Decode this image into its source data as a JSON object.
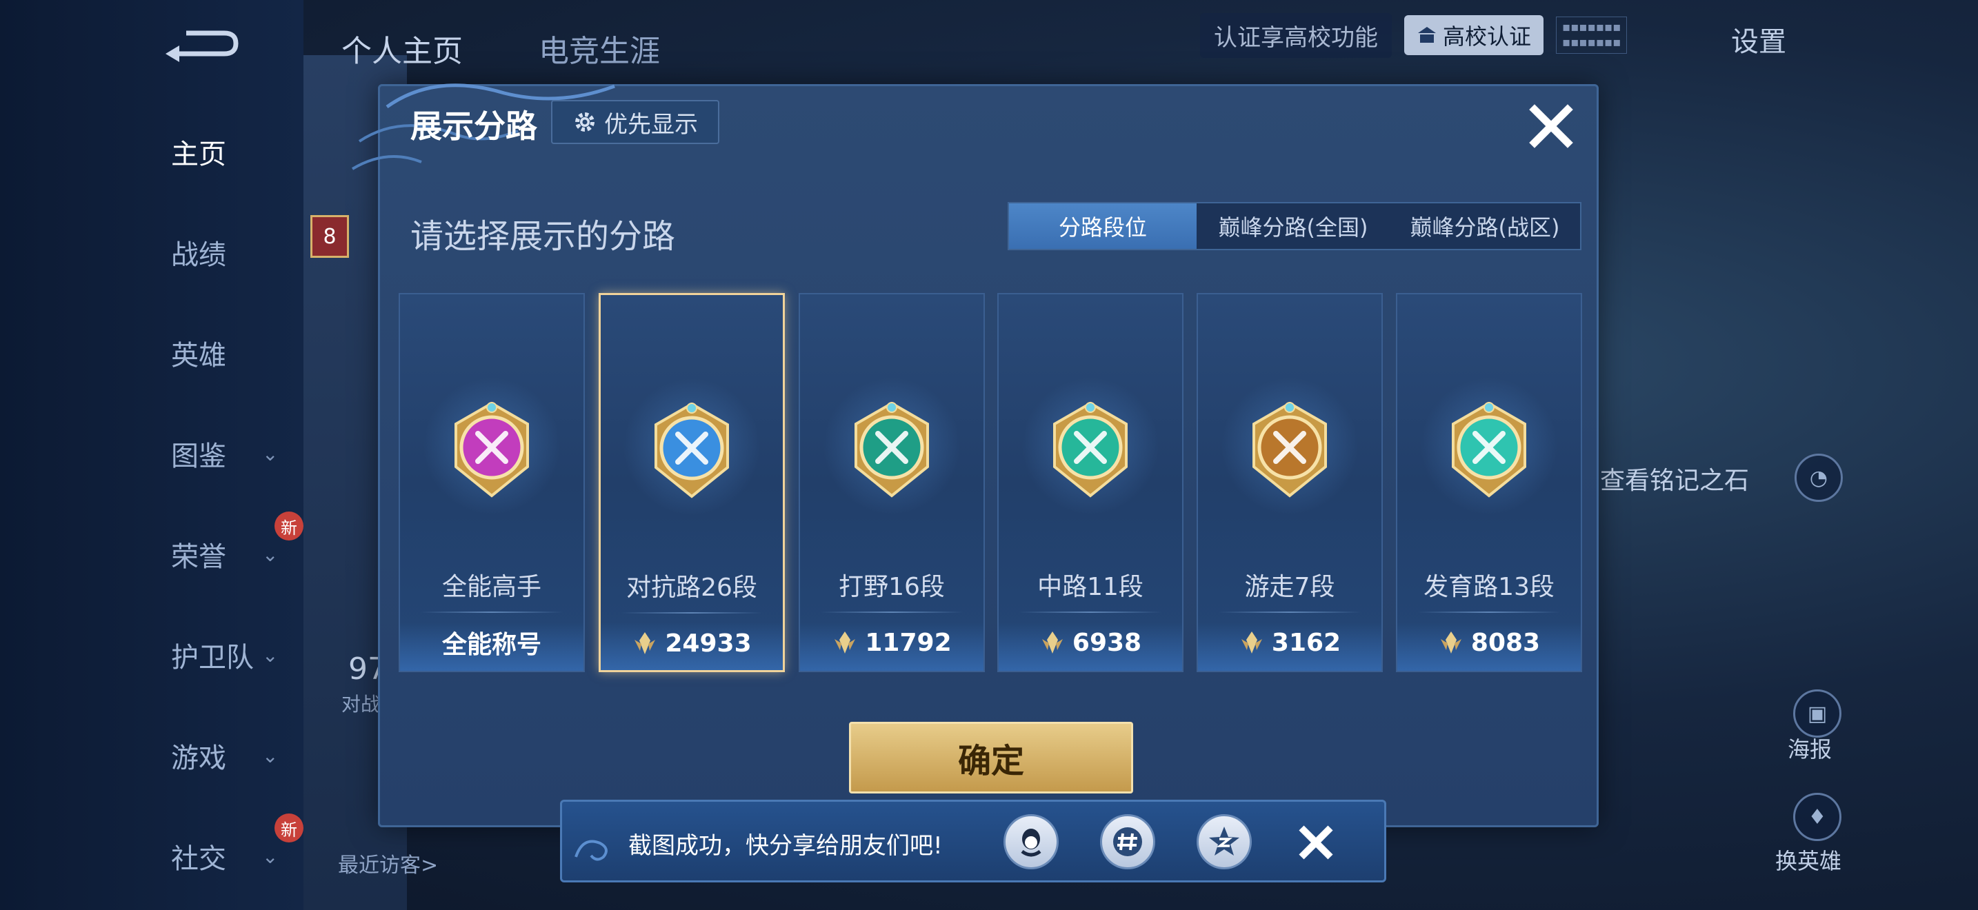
{
  "sidebar": {
    "items": [
      {
        "label": "主页",
        "active": true,
        "chevron": false,
        "new": false
      },
      {
        "label": "战绩",
        "active": false,
        "chevron": false,
        "new": false
      },
      {
        "label": "英雄",
        "active": false,
        "chevron": false,
        "new": false
      },
      {
        "label": "图鉴",
        "active": false,
        "chevron": true,
        "new": false
      },
      {
        "label": "荣誉",
        "active": false,
        "chevron": true,
        "new": true
      },
      {
        "label": "护卫队",
        "active": false,
        "chevron": true,
        "new": false
      },
      {
        "label": "游戏",
        "active": false,
        "chevron": true,
        "new": false
      },
      {
        "label": "社交",
        "active": false,
        "chevron": true,
        "new": true
      }
    ],
    "new_badge": "新"
  },
  "top_tabs": [
    "个人主页",
    "电竞生涯"
  ],
  "header_right": {
    "cert_text": "认证享高校功能",
    "cert_button": "高校认证",
    "settings": "设置"
  },
  "background": {
    "level": "8",
    "battles_value": "97",
    "battles_label": "对战",
    "recent_visitors": "最近访客>",
    "inscription_hint": "查看铭记之石",
    "poster": "海报",
    "change_hero": "换英雄"
  },
  "modal": {
    "title": "展示分路",
    "priority_button": "优先显示",
    "subtitle": "请选择展示的分路",
    "segment_tabs": [
      "分路段位",
      "巅峰分路(全国)",
      "巅峰分路(战区)"
    ],
    "segment_active_index": 0,
    "cards": [
      {
        "name": "全能高手",
        "value": "全能称号",
        "has_points_icon": false,
        "selected": false,
        "emblem": "all-round-emblem-icon",
        "color": "#c23dbd"
      },
      {
        "name": "对抗路26段",
        "value": "24933",
        "has_points_icon": true,
        "selected": true,
        "emblem": "clash-lane-emblem-icon",
        "color": "#3a8fe0"
      },
      {
        "name": "打野16段",
        "value": "11792",
        "has_points_icon": true,
        "selected": false,
        "emblem": "jungle-emblem-icon",
        "color": "#1f9e86"
      },
      {
        "name": "中路11段",
        "value": "6938",
        "has_points_icon": true,
        "selected": false,
        "emblem": "mid-lane-emblem-icon",
        "color": "#26b79a"
      },
      {
        "name": "游走7段",
        "value": "3162",
        "has_points_icon": true,
        "selected": false,
        "emblem": "roam-emblem-icon",
        "color": "#b9772c"
      },
      {
        "name": "发育路13段",
        "value": "8083",
        "has_points_icon": true,
        "selected": false,
        "emblem": "farm-lane-emblem-icon",
        "color": "#2fc4b0"
      }
    ],
    "confirm_button": "确定"
  },
  "toast": {
    "text": "截图成功，快分享给朋友们吧!",
    "share_targets": [
      "qq-share-icon",
      "topic-share-icon",
      "qzone-share-icon"
    ]
  },
  "colors": {
    "accent_gold": "#e7cc8a",
    "selected_border": "#f0d39a",
    "active_tab": "#4d86c8"
  }
}
